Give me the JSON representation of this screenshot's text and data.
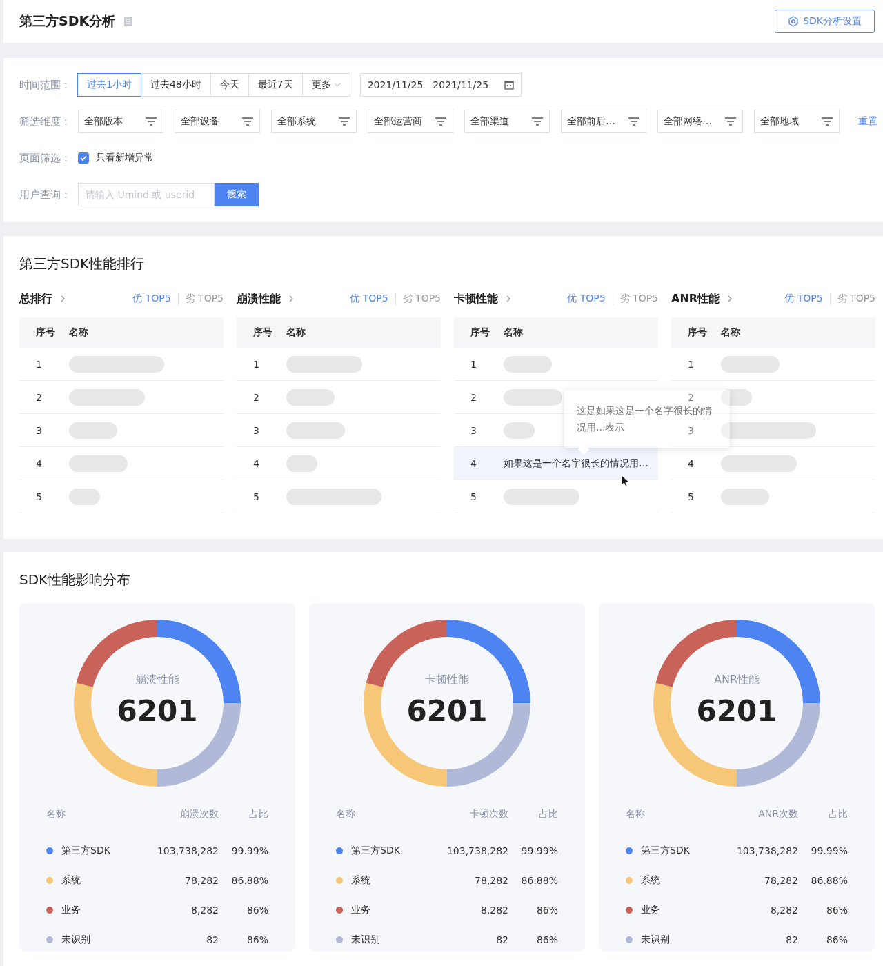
{
  "header": {
    "title": "第三方SDK分析",
    "settings_button": "SDK分析设置"
  },
  "filters": {
    "time_range": {
      "label": "时间范围：",
      "options": [
        {
          "label": "过去1小时",
          "selected": true
        },
        {
          "label": "过去48小时",
          "selected": false
        },
        {
          "label": "今天",
          "selected": false
        },
        {
          "label": "最近7天",
          "selected": false
        }
      ],
      "more": "更多",
      "date_range": "2021/11/25—2021/11/25"
    },
    "dimensions": {
      "label": "筛选维度：",
      "selects": [
        "全部版本",
        "全部设备",
        "全部系统",
        "全部运营商",
        "全部渠道",
        "全部前后…",
        "全部网络…",
        "全部地域"
      ],
      "reset": "重置"
    },
    "page_filter": {
      "label": "页面筛选：",
      "checkbox": {
        "label": "只看新增异常",
        "checked": true
      }
    },
    "user_query": {
      "label": "用户查询：",
      "placeholder": "请输入 Umind 或 userid",
      "button": "搜索"
    }
  },
  "ranking": {
    "title": "第三方SDK性能排行",
    "panels": [
      {
        "title": "总排行",
        "tabs": [
          {
            "label": "优 TOP5",
            "selected": true
          },
          {
            "label": "劣 TOP5",
            "selected": false
          }
        ],
        "columns": [
          "序号",
          "名称"
        ],
        "rows": [
          {
            "index": "1",
            "redacted": true
          },
          {
            "index": "2",
            "redacted": true
          },
          {
            "index": "3",
            "redacted": true
          },
          {
            "index": "4",
            "redacted": true
          },
          {
            "index": "5",
            "redacted": true
          }
        ]
      },
      {
        "title": "崩溃性能",
        "tabs": [
          {
            "label": "优 TOP5",
            "selected": true
          },
          {
            "label": "劣 TOP5",
            "selected": false
          }
        ],
        "columns": [
          "序号",
          "名称"
        ],
        "rows": [
          {
            "index": "1",
            "redacted": true
          },
          {
            "index": "2",
            "redacted": true
          },
          {
            "index": "3",
            "redacted": true
          },
          {
            "index": "4",
            "redacted": true
          },
          {
            "index": "5",
            "redacted": true
          }
        ]
      },
      {
        "title": "卡顿性能",
        "tabs": [
          {
            "label": "优 TOP5",
            "selected": true
          },
          {
            "label": "劣 TOP5",
            "selected": false
          }
        ],
        "columns": [
          "序号",
          "名称"
        ],
        "rows": [
          {
            "index": "1",
            "redacted": true
          },
          {
            "index": "2",
            "redacted": true
          },
          {
            "index": "3",
            "redacted": true
          },
          {
            "index": "4",
            "name": "如果这是一个名字很长的情况用…",
            "hovered": true
          },
          {
            "index": "5",
            "redacted": true
          }
        ],
        "tooltip": "这是如果这是一个名字很长的情况用...表示"
      },
      {
        "title": "ANR性能",
        "tabs": [
          {
            "label": "优 TOP5",
            "selected": true
          },
          {
            "label": "劣 TOP5",
            "selected": false
          }
        ],
        "columns": [
          "序号",
          "名称"
        ],
        "rows": [
          {
            "index": "1",
            "redacted": true
          },
          {
            "index": "2",
            "redacted": true
          },
          {
            "index": "3",
            "redacted": true
          },
          {
            "index": "4",
            "redacted": true
          },
          {
            "index": "5",
            "redacted": true
          }
        ]
      }
    ]
  },
  "distribution": {
    "title": "SDK性能影响分布",
    "cards": [
      {
        "label": "崩溃性能",
        "total": "6201",
        "columns": [
          "名称",
          "崩溃次数",
          "占比"
        ],
        "rows": [
          {
            "name": "第三方SDK",
            "count": "103,738,282",
            "share": "99.99%",
            "color": "#4e84f2"
          },
          {
            "name": "系统",
            "count": "78,282",
            "share": "86.88%",
            "color": "#f5c776"
          },
          {
            "name": "业务",
            "count": "8,282",
            "share": "86%",
            "color": "#c9635a"
          },
          {
            "name": "未识别",
            "count": "82",
            "share": "86%",
            "color": "#b0b9d8"
          }
        ]
      },
      {
        "label": "卡顿性能",
        "total": "6201",
        "columns": [
          "名称",
          "卡顿次数",
          "占比"
        ],
        "rows": [
          {
            "name": "第三方SDK",
            "count": "103,738,282",
            "share": "99.99%",
            "color": "#4e84f2"
          },
          {
            "name": "系统",
            "count": "78,282",
            "share": "86.88%",
            "color": "#f5c776"
          },
          {
            "name": "业务",
            "count": "8,282",
            "share": "86%",
            "color": "#c9635a"
          },
          {
            "name": "未识别",
            "count": "82",
            "share": "86%",
            "color": "#b0b9d8"
          }
        ]
      },
      {
        "label": "ANR性能",
        "total": "6201",
        "columns": [
          "名称",
          "ANR次数",
          "占比"
        ],
        "rows": [
          {
            "name": "第三方SDK",
            "count": "103,738,282",
            "share": "99.99%",
            "color": "#4e84f2"
          },
          {
            "name": "系统",
            "count": "78,282",
            "share": "86.88%",
            "color": "#f5c776"
          },
          {
            "name": "业务",
            "count": "8,282",
            "share": "86%",
            "color": "#c9635a"
          },
          {
            "name": "未识别",
            "count": "82",
            "share": "86%",
            "color": "#b0b9d8"
          }
        ]
      }
    ]
  }
}
